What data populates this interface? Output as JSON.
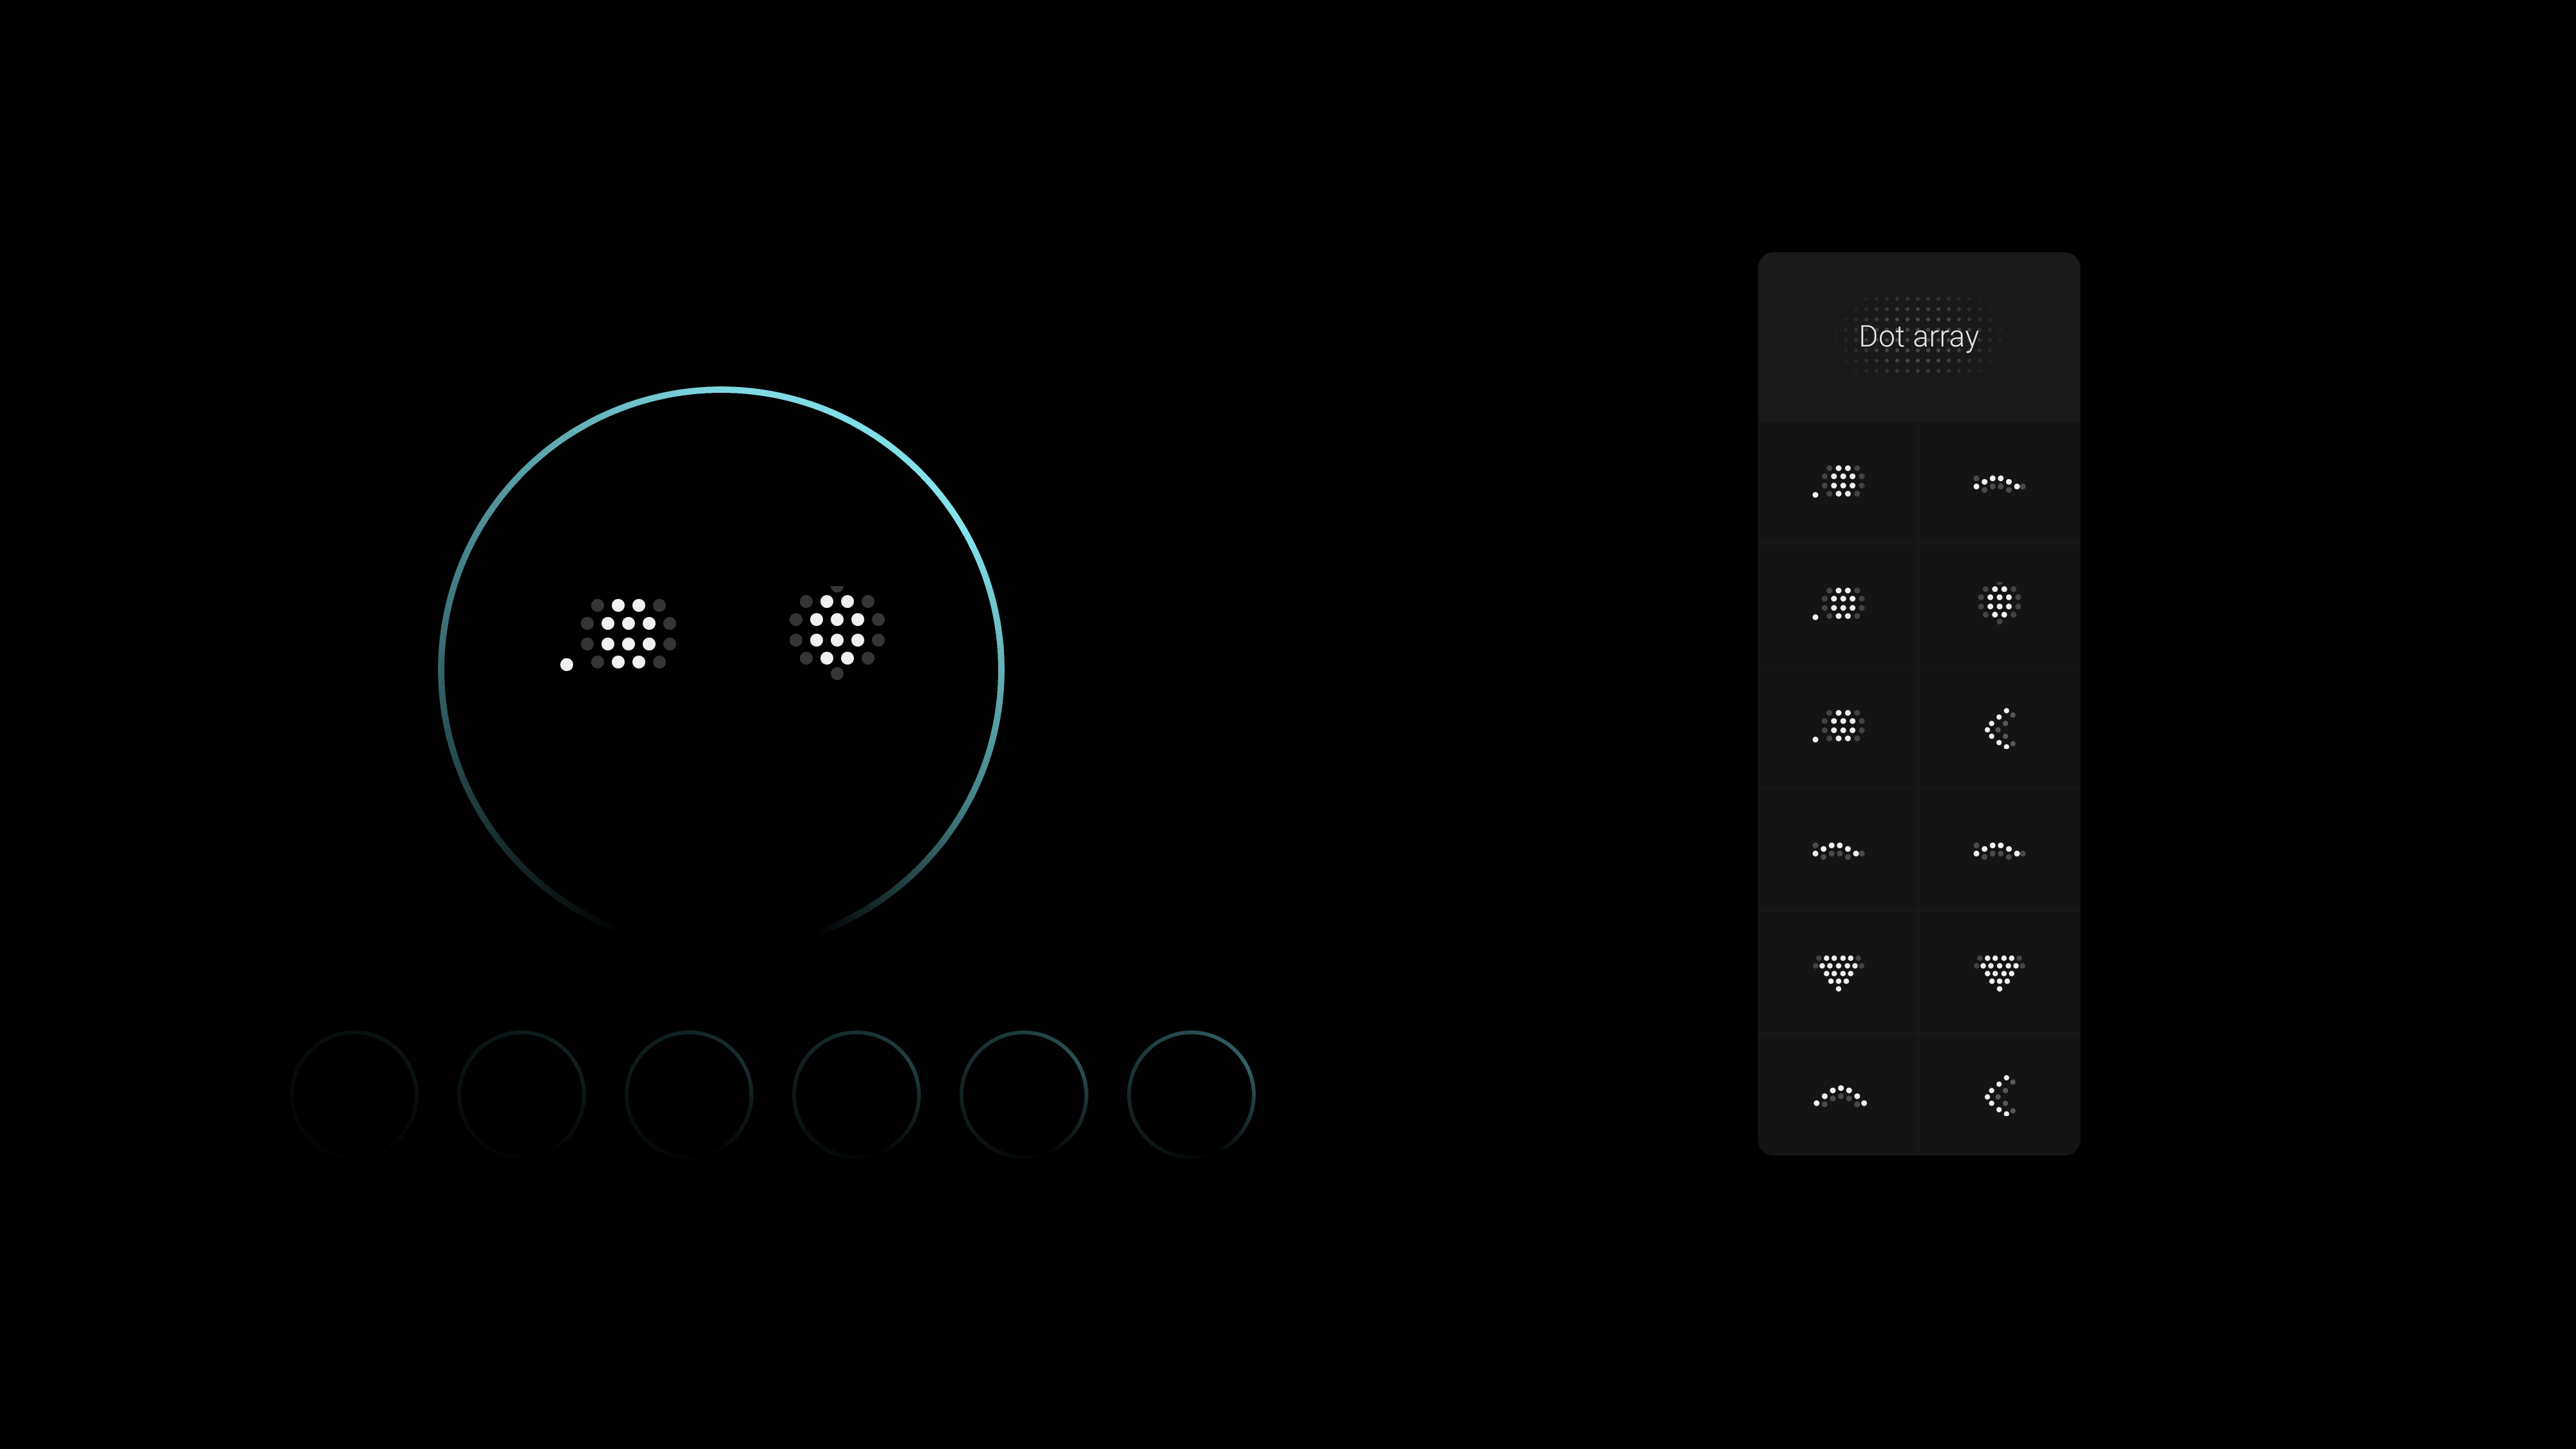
{
  "panel": {
    "title": "Dot array"
  },
  "avatar": {
    "left_eye_name": "minus-lens-icon",
    "right_eye_name": "hash-cluster-icon"
  },
  "ring_thumbnails": {
    "count": 6
  },
  "eye_options": [
    {
      "left": "minus-lens-icon",
      "right": "wave-low-icon"
    },
    {
      "left": "minus-lens-icon",
      "right": "hash-cluster-icon"
    },
    {
      "left": "minus-lens-icon",
      "right": "chevron-left-icon"
    },
    {
      "left": "wave-low-icon",
      "right": "wave-low-icon"
    },
    {
      "left": "heart-icon",
      "right": "heart-icon"
    },
    {
      "left": "arc-up-icon",
      "right": "chevron-left-icon"
    }
  ]
}
